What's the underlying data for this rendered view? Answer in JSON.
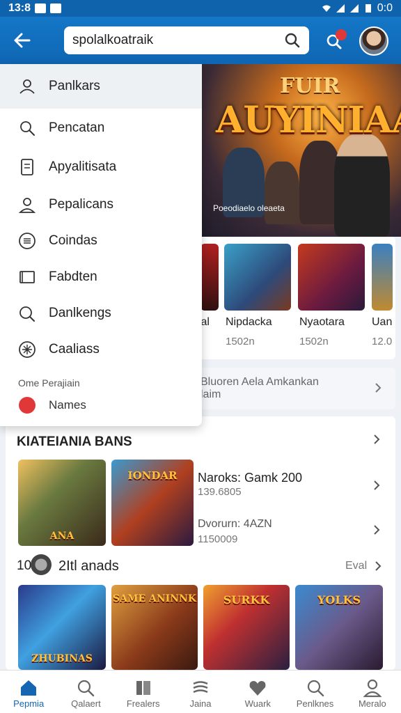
{
  "status_bar": {
    "time": "13:8",
    "right_text": "0:0"
  },
  "search": {
    "query": "spolalkoatraik"
  },
  "hero": {
    "title_top": "FUIR",
    "title_main": "AUYINIAAI",
    "caption": "Poeodiaelo oleaeta"
  },
  "carousel": [
    {
      "title": "Ial",
      "meta": ""
    },
    {
      "title": "Nipdacka",
      "meta": "1502n"
    },
    {
      "title": "Nyaotara",
      "meta": "1502n"
    },
    {
      "title": "Uan",
      "meta": "12.0"
    }
  ],
  "info_banner": {
    "line1": "Bluoren Aela Amkankan",
    "line2": "laim"
  },
  "section1": {
    "title": "KIATEIANIA BANS",
    "items": [
      {
        "title": "Naroks: Gamk 200",
        "meta": "139.6805"
      },
      {
        "title": "Dvorurn: 4AZN",
        "meta": "1150009"
      }
    ],
    "thumb_labels": [
      "ANA",
      "IONDAR"
    ]
  },
  "section2": {
    "prefix": "10",
    "title": "2Itl anads",
    "action": "Eval",
    "thumb_labels": [
      "ZHUBINAS",
      "SAME ANINNK",
      "SURKK",
      "YOLKS"
    ]
  },
  "dropdown": {
    "items": [
      {
        "label": "Panlkars",
        "icon": "user-shield-icon"
      },
      {
        "label": "Pencatan",
        "icon": "search-icon"
      },
      {
        "label": "Apyalitisata",
        "icon": "document-icon"
      },
      {
        "label": "Pepalicans",
        "icon": "person-icon"
      },
      {
        "label": "Coindas",
        "icon": "list-circle-icon"
      },
      {
        "label": "Fabdten",
        "icon": "folder-icon"
      },
      {
        "label": "Danlkengs",
        "icon": "search-alt-icon"
      },
      {
        "label": "Caaliass",
        "icon": "gear-circle-icon"
      }
    ],
    "footer_small": "Ome Perajiain",
    "footer_item": "Names"
  },
  "bottom_nav": [
    {
      "label": "Pepmia",
      "icon": "home-icon",
      "active": true
    },
    {
      "label": "Qalaert",
      "icon": "search-icon",
      "active": false
    },
    {
      "label": "Frealers",
      "icon": "book-icon",
      "active": false
    },
    {
      "label": "Jaina",
      "icon": "stack-icon",
      "active": false
    },
    {
      "label": "Wuark",
      "icon": "heart-icon",
      "active": false
    },
    {
      "label": "Penlknes",
      "icon": "search-icon",
      "active": false
    },
    {
      "label": "Meralo",
      "icon": "person-icon",
      "active": false
    }
  ],
  "colors": {
    "primary": "#1466b3",
    "accent_red": "#e03838"
  }
}
